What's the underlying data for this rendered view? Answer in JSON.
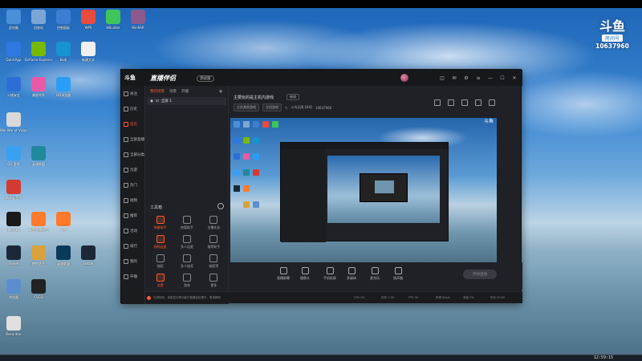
{
  "desktop": {
    "icons": [
      {
        "label": "此电脑",
        "color": "#4a90d9"
      },
      {
        "label": "回收站",
        "color": "#7aa7d6"
      },
      {
        "label": "控制面板",
        "color": "#3c7fd0"
      },
      {
        "label": "WPS",
        "color": "#e94b3c"
      },
      {
        "label": "HBuilder",
        "color": "#3ec65a"
      },
      {
        "label": "WinRAR",
        "color": "#8b5a8c"
      },
      {
        "label": "QuickApp",
        "color": "#2f78e0"
      },
      {
        "label": "GeForce Experience",
        "color": "#76b900"
      },
      {
        "label": "Kodi",
        "color": "#1793d1"
      },
      {
        "label": "新建文本",
        "color": "#f0f0f0"
      },
      {
        "label": "火绒安全",
        "color": "#2b6fd6"
      },
      {
        "label": "美图秀秀",
        "color": "#e85aa8"
      },
      {
        "label": "QQ浏览器",
        "color": "#2a9df4"
      },
      {
        "label": "Win War of Vision",
        "color": "#d9d9d9"
      },
      {
        "label": "QQ 游戏",
        "color": "#3aa0f0"
      },
      {
        "label": "英雄联盟",
        "color": "#1e8a9c"
      },
      {
        "label": "网易云音乐",
        "color": "#d33a31"
      },
      {
        "label": "腾讯QQ",
        "color": "#1a1a1a"
      },
      {
        "label": "斗鱼直播伴侣",
        "color": "#ff7a2a"
      },
      {
        "label": "斗鱼",
        "color": "#ff7a2a"
      },
      {
        "label": "Steam",
        "color": "#1b2838"
      },
      {
        "label": "绝地求生",
        "color": "#d9a23a"
      },
      {
        "label": "英雄联盟",
        "color": "#0a3a5a"
      },
      {
        "label": "Steam",
        "color": "#1b2838"
      },
      {
        "label": "浏览器",
        "color": "#5c8ecf"
      },
      {
        "label": "CSGO",
        "color": "#222222"
      },
      {
        "label": "Decorator",
        "color": "#e0e0e0"
      }
    ]
  },
  "room_badge": {
    "logo": "斗鱼",
    "label": "房间号",
    "number": "10637960"
  },
  "app": {
    "logo": "斗鱼",
    "name": "直播伴侣",
    "badge": "测试版",
    "rail": [
      "关注",
      "历史",
      "首页",
      "全部直播",
      "全部分类",
      "页游",
      "热门",
      "视频",
      "推荐",
      "活动",
      "排行",
      "我的",
      "开播"
    ],
    "scene_tabs": [
      "我的场景",
      "场景",
      "开播"
    ],
    "scene_item": "全屏 1",
    "tools_title": "工具箱",
    "tools": [
      "弹幕助手",
      "房管助手",
      "主播任务",
      "视频连麦",
      "多人连麦",
      "推荐助手",
      "抽奖",
      "多人抽奖",
      "抽奖等",
      "设置",
      "游戏",
      "更多"
    ],
    "notice": "礼物特效、消息显示等功能已做兼容处理中，敬请期待",
    "room_title": "主要玩的是主机内游戏",
    "edit_label": "修改",
    "categories": [
      "主机其他游戏",
      "主机游戏",
      "火鸟无限 QHQ",
      "10637960"
    ],
    "controls": [
      "直播屏幕",
      "摄像头",
      "手机投屏",
      "多媒体",
      "麦克风",
      "扬声器"
    ],
    "start_label": "开始直播",
    "stats": [
      "CPU 0%",
      "内存 1.2G",
      "FPS 30",
      "码率 0kb/s",
      "丢帧 0%",
      "时长 00:00"
    ]
  },
  "taskbar": {
    "clock": "12:59:15"
  }
}
